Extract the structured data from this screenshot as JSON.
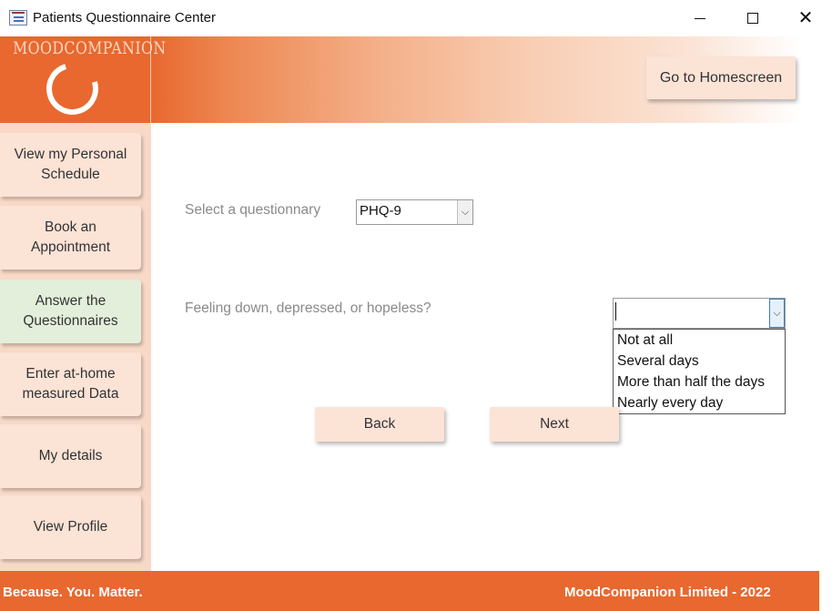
{
  "window": {
    "title": "Patients Questionnaire Center",
    "minimize_icon": "minimize-icon",
    "maximize_icon": "maximize-icon",
    "close_icon": "close-icon"
  },
  "header": {
    "logo_text": "MOODCOMPANION",
    "home_button": "Go to Homescreen"
  },
  "sidebar": {
    "items": [
      {
        "label": "View my Personal Schedule"
      },
      {
        "label": "Book an Appointment"
      },
      {
        "label": "Answer the Questionnaires",
        "active": true
      },
      {
        "label": "Enter at-home measured Data"
      },
      {
        "label": "My details"
      },
      {
        "label": "View Profile"
      }
    ]
  },
  "main": {
    "questionnaire_label": "Select a questionnary",
    "questionnaire_value": "PHQ-9",
    "question_text": "Feeling down, depressed, or hopeless?",
    "answer_value": "",
    "answer_options": [
      "Not at all",
      "Several days",
      "More than half the days",
      "Nearly every day"
    ],
    "back_button": "Back",
    "next_button": "Next"
  },
  "footer": {
    "tagline": "Because. You. Matter.",
    "company": "MoodCompanion Limited - 2022"
  },
  "colors": {
    "brand_orange": "#e8682f",
    "button_peach": "#fbe3d6",
    "active_green": "#e3efdb",
    "sidebar_bg": "#f8d9c7"
  }
}
